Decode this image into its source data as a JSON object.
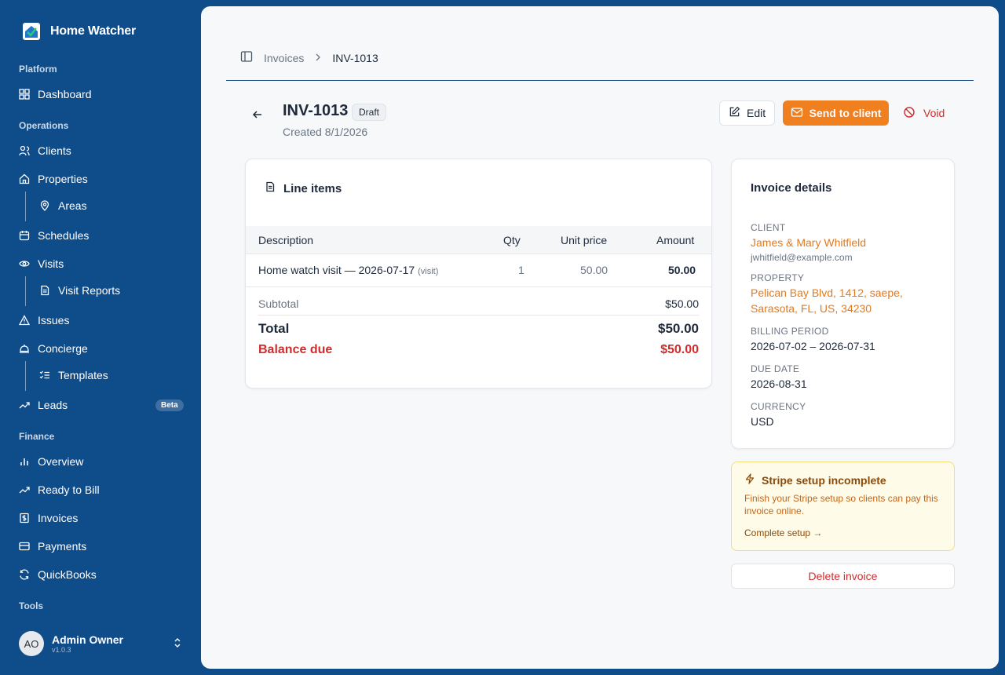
{
  "brand": {
    "name": "Home Watcher",
    "logo_icon": "house-check-icon"
  },
  "sidebar": {
    "sections": {
      "platform": "Platform",
      "operations": "Operations",
      "finance": "Finance",
      "tools": "Tools"
    },
    "items": {
      "dashboard": "Dashboard",
      "clients": "Clients",
      "properties": "Properties",
      "areas": "Areas",
      "schedules": "Schedules",
      "visits": "Visits",
      "visit_reports": "Visit Reports",
      "issues": "Issues",
      "concierge": "Concierge",
      "templates": "Templates",
      "leads": "Leads",
      "leads_badge": "Beta",
      "overview": "Overview",
      "ready_to_bill": "Ready to Bill",
      "invoices": "Invoices",
      "payments": "Payments",
      "quickbooks": "QuickBooks"
    },
    "user": {
      "initials": "AO",
      "name": "Admin Owner",
      "version": "v1.0.3"
    }
  },
  "breadcrumb": {
    "parent": "Invoices",
    "current": "INV-1013"
  },
  "invoice": {
    "number": "INV-1013",
    "status": "Draft",
    "created": "Created 8/1/2026"
  },
  "actions": {
    "edit": "Edit",
    "send": "Send to client",
    "void": "Void",
    "delete": "Delete invoice"
  },
  "line_items": {
    "title": "Line items",
    "columns": {
      "description": "Description",
      "qty": "Qty",
      "unit_price": "Unit price",
      "amount": "Amount"
    },
    "rows": [
      {
        "description": "Home watch visit — 2026-07-17",
        "tag": "(visit)",
        "qty": "1",
        "unit_price": "50.00",
        "amount": "50.00"
      }
    ],
    "subtotal_label": "Subtotal",
    "subtotal": "$50.00",
    "total_label": "Total",
    "total": "$50.00",
    "balance_label": "Balance due",
    "balance": "$50.00"
  },
  "details": {
    "title": "Invoice details",
    "client_label": "CLIENT",
    "client_name": "James & Mary Whitfield",
    "client_email": "jwhitfield@example.com",
    "property_label": "PROPERTY",
    "property_line1": "Pelican Bay Blvd, 1412, saepe,",
    "property_line2": "Sarasota, FL, US, 34230",
    "billing_label": "BILLING PERIOD",
    "billing_period": "2026-07-02 – 2026-07-31",
    "due_label": "DUE DATE",
    "due_date": "2026-08-31",
    "currency_label": "CURRENCY",
    "currency": "USD"
  },
  "stripe": {
    "title": "Stripe setup incomplete",
    "description": "Finish your Stripe setup so clients can pay this invoice online.",
    "link": "Complete setup →"
  },
  "colors": {
    "sidebar_bg": "#0f4c8a",
    "accent_orange": "#f07f1f",
    "danger_red": "#d12c2c"
  }
}
